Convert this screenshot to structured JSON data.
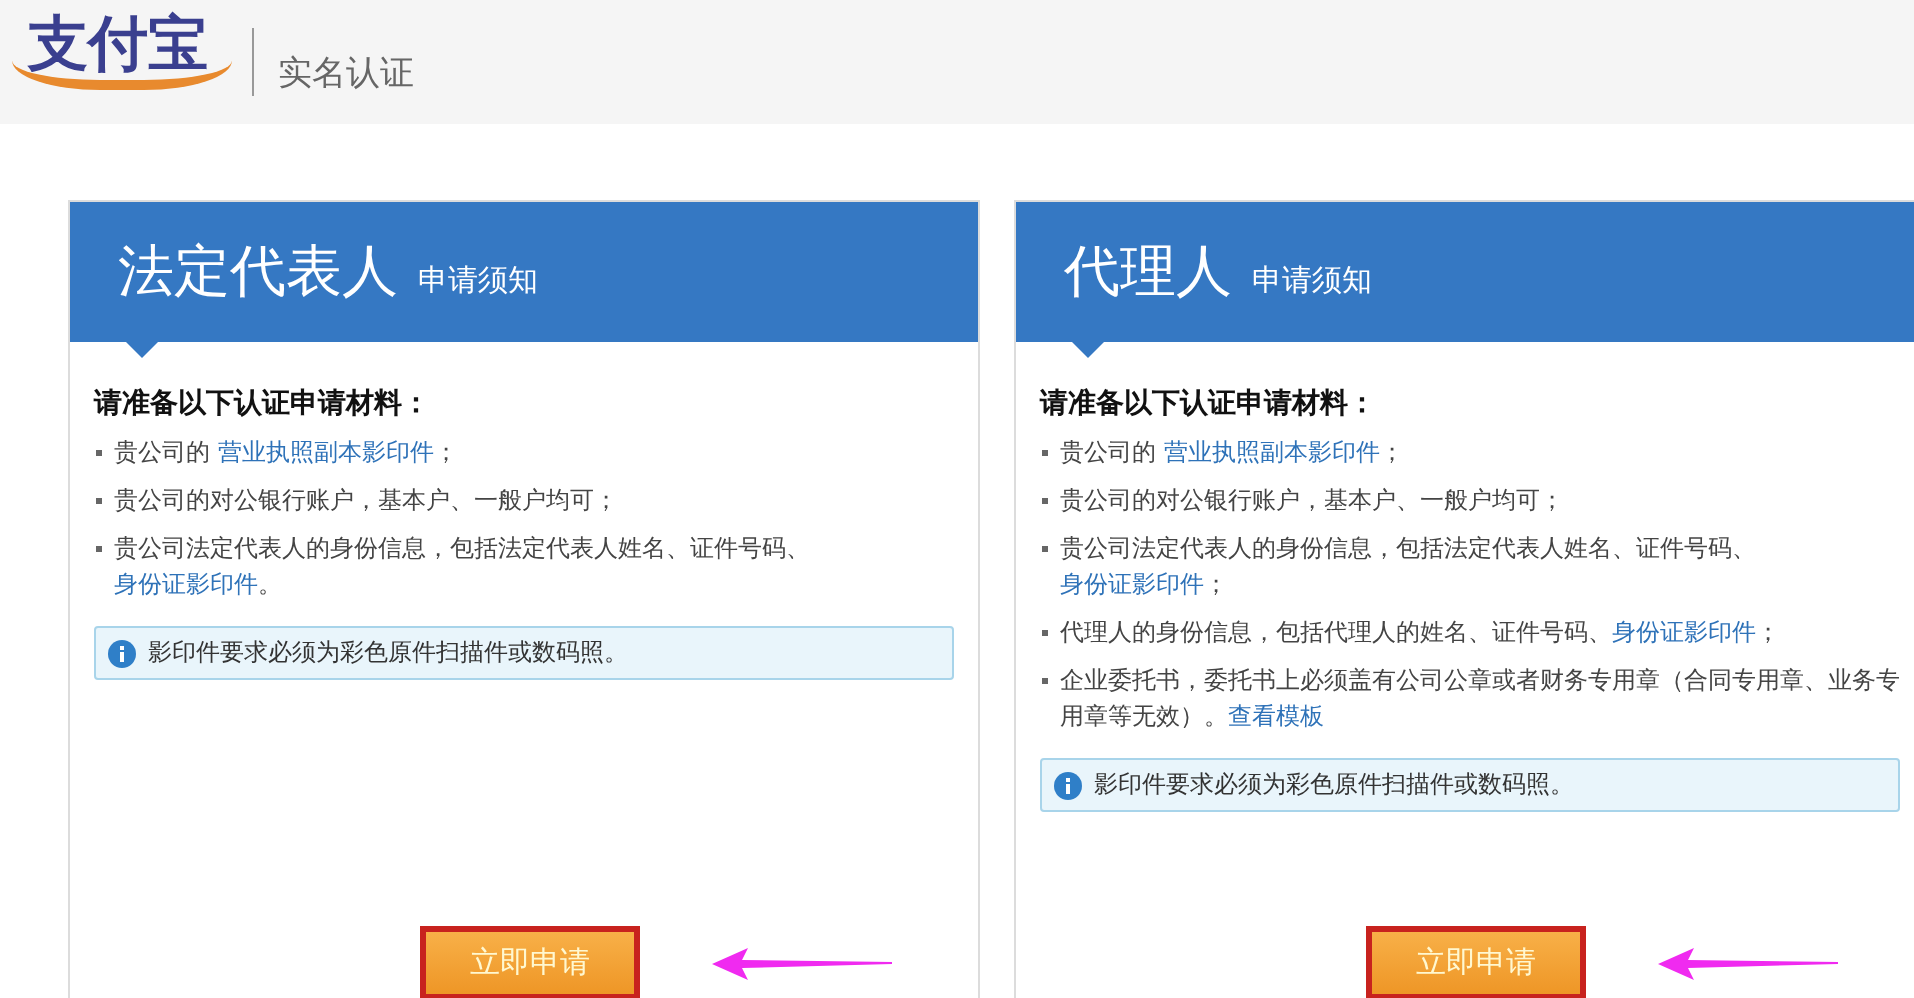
{
  "header": {
    "logo": "支付宝",
    "title": "实名认证"
  },
  "cards": [
    {
      "title": "法定代表人",
      "subtitle": "申请须知",
      "heading": "请准备以下认证申请材料：",
      "items": [
        {
          "parts": [
            {
              "kind": "text",
              "text": "贵公司的 "
            },
            {
              "kind": "link",
              "text": "营业执照副本影印件"
            },
            {
              "kind": "text",
              "text": "；"
            }
          ]
        },
        {
          "parts": [
            {
              "kind": "text",
              "text": "贵公司的对公银行账户，基本户、一般户均可；"
            }
          ]
        },
        {
          "parts": [
            {
              "kind": "text",
              "text": "贵公司法定代表人的身份信息，包括法定代表人姓名、证件号码、"
            },
            {
              "kind": "link",
              "text": "身份证影印件"
            },
            {
              "kind": "text",
              "text": "。"
            }
          ]
        }
      ],
      "note": "影印件要求必须为彩色原件扫描件或数码照。",
      "button": "立即申请"
    },
    {
      "title": "代理人",
      "subtitle": "申请须知",
      "heading": "请准备以下认证申请材料：",
      "items": [
        {
          "parts": [
            {
              "kind": "text",
              "text": "贵公司的 "
            },
            {
              "kind": "link",
              "text": "营业执照副本影印件"
            },
            {
              "kind": "text",
              "text": "；"
            }
          ]
        },
        {
          "parts": [
            {
              "kind": "text",
              "text": "贵公司的对公银行账户，基本户、一般户均可；"
            }
          ]
        },
        {
          "parts": [
            {
              "kind": "text",
              "text": "贵公司法定代表人的身份信息，包括法定代表人姓名、证件号码、"
            },
            {
              "kind": "link",
              "text": "身份证影印件"
            },
            {
              "kind": "text",
              "text": "；"
            }
          ]
        },
        {
          "parts": [
            {
              "kind": "text",
              "text": "代理人的身份信息，包括代理人的姓名、证件号码、"
            },
            {
              "kind": "link",
              "text": "身份证影印件"
            },
            {
              "kind": "text",
              "text": "；"
            }
          ]
        },
        {
          "parts": [
            {
              "kind": "text",
              "text": "企业委托书，委托书上必须盖有公司公章或者财务专用章（合同专用章、业务专用章等无效）。"
            },
            {
              "kind": "link",
              "text": "查看模板"
            }
          ]
        }
      ],
      "note": "影印件要求必须为彩色原件扫描件或数码照。",
      "button": "立即申请"
    }
  ]
}
